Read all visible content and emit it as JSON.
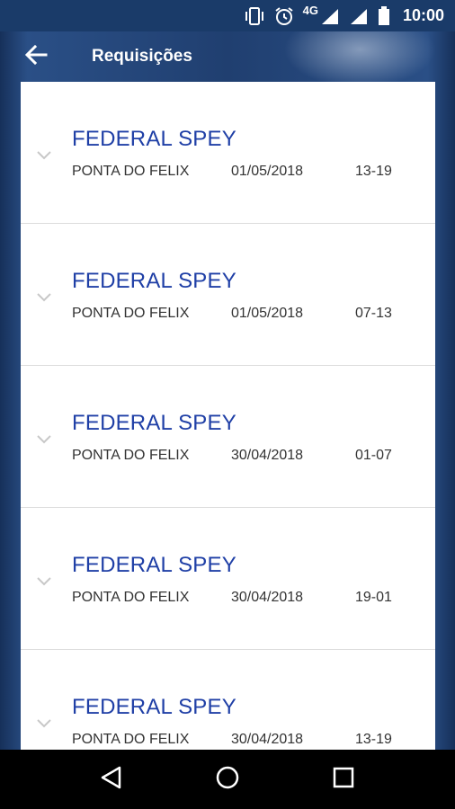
{
  "status_bar": {
    "network": "4G",
    "time": "10:00",
    "icons": [
      "vibrate-icon",
      "alarm-icon",
      "signal-icon",
      "signal-icon",
      "battery-icon"
    ]
  },
  "header": {
    "title": "Requisições",
    "back_icon": "arrow-left-icon"
  },
  "requisitions": [
    {
      "title": "FEDERAL SPEY",
      "location": "PONTA DO FELIX",
      "date": "01/05/2018",
      "time": "13-19"
    },
    {
      "title": "FEDERAL SPEY",
      "location": "PONTA DO FELIX",
      "date": "01/05/2018",
      "time": "07-13"
    },
    {
      "title": "FEDERAL SPEY",
      "location": "PONTA DO FELIX",
      "date": "30/04/2018",
      "time": "01-07"
    },
    {
      "title": "FEDERAL SPEY",
      "location": "PONTA DO FELIX",
      "date": "30/04/2018",
      "time": "19-01"
    },
    {
      "title": "FEDERAL SPEY",
      "location": "PONTA DO FELIX",
      "date": "30/04/2018",
      "time": "13-19"
    }
  ],
  "nav_bar": {
    "icons": [
      "back-triangle-icon",
      "home-circle-icon",
      "recents-square-icon"
    ]
  },
  "colors": {
    "accent": "#1f3fa6",
    "app_bar": "#1a3b69"
  }
}
